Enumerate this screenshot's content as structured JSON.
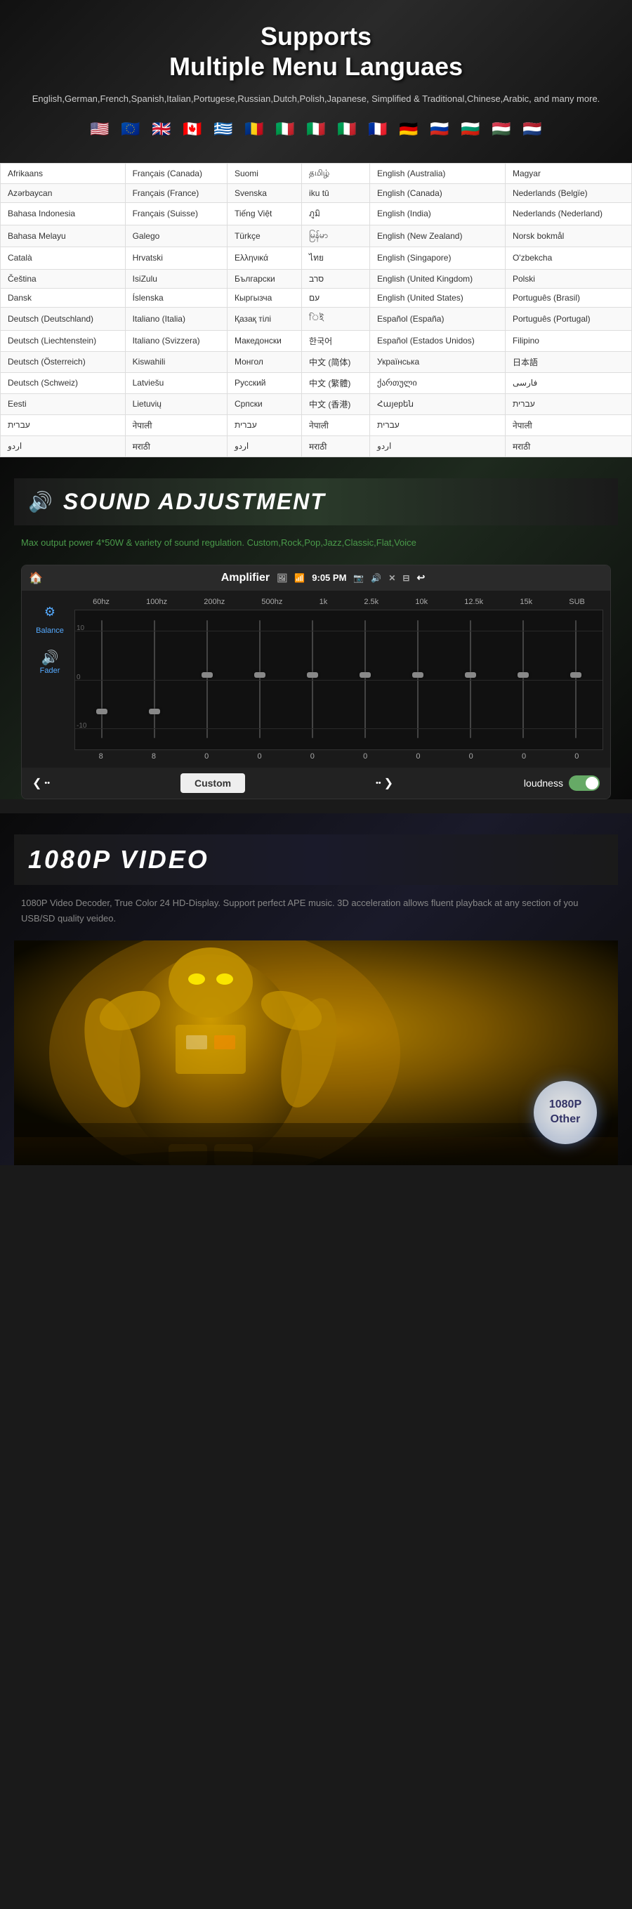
{
  "languages_section": {
    "title_line1": "Supports",
    "title_line2": "Multiple Menu Languaes",
    "subtitle": "English,German,French,Spanish,Italian,Portugese,Russian,Dutch,Polish,Japanese,\nSimplified & Traditional,Chinese,Arabic, and many more.",
    "flags": [
      "🇺🇸",
      "🇪🇺",
      "🇬🇧",
      "🇨🇦",
      "🇬🇷",
      "🇷🇴",
      "🇮🇹",
      "🇮🇹",
      "🇮🇹",
      "🇫🇷",
      "🇩🇪",
      "🇷🇺",
      "🇧🇬",
      "🇭🇺",
      "🇳🇱"
    ],
    "table_rows": [
      [
        "Afrikaans",
        "Français (Canada)",
        "Suomi",
        "தமிழ்",
        "English (Australia)",
        "Magyar"
      ],
      [
        "Azərbaycan",
        "Français (France)",
        "Svenska",
        "iku tū",
        "English (Canada)",
        "Nederlands (Belgïe)"
      ],
      [
        "Bahasa Indonesia",
        "Français (Suisse)",
        "Tiếng Việt",
        "ภูมิ",
        "English (India)",
        "Nederlands (Nederland)"
      ],
      [
        "Bahasa Melayu",
        "Galego",
        "Türkçe",
        "မြန်မာ",
        "English (New Zealand)",
        "Norsk bokmål"
      ],
      [
        "Català",
        "Hrvatski",
        "Ελληνικά",
        "ไทย",
        "English (Singapore)",
        "O'zbekcha"
      ],
      [
        "Čeština",
        "IsiZulu",
        "Български",
        "סרב",
        "English (United Kingdom)",
        "Polski"
      ],
      [
        "Dansk",
        "Íslenska",
        "Кыргызча",
        "עם",
        "English (United States)",
        "Português (Brasil)"
      ],
      [
        "Deutsch (Deutschland)",
        "Italiano (Italia)",
        "Қазақ тілі",
        "িই",
        "Español (España)",
        "Português (Portugal)"
      ],
      [
        "Deutsch (Liechtenstein)",
        "Italiano (Svizzera)",
        "Македонски",
        "한국어",
        "Español (Estados Unidos)",
        "Filipino"
      ],
      [
        "Deutsch (Österreich)",
        "Kiswahili",
        "Монгол",
        "中文 (简体)",
        "Українська",
        "日本語"
      ],
      [
        "Deutsch (Schweiz)",
        "Latviešu",
        "Русский",
        "中文 (繁體)",
        "ქართული",
        "فارسی"
      ],
      [
        "Eesti",
        "Lietuvių",
        "Српски",
        "中文 (香港)",
        "Հայерեն",
        "עברית"
      ],
      [
        "עברית",
        "नेपाली",
        "עברית",
        "नेपाली",
        "עברית",
        "नेपाली"
      ],
      [
        "اردو",
        "मराठी",
        "اردو",
        "मराठी",
        "اردو",
        "मराठी"
      ]
    ]
  },
  "sound_section": {
    "title": "SOUND ADJUSTMENT",
    "description": "Max output power 4*50W & variety of sound regulation.\nCustom,Rock,Pop,Jazz,Classic,Flat,Voice",
    "amplifier": {
      "label": "Amplifier",
      "time": "9:05 PM",
      "balance_label": "Balance",
      "fader_label": "Fader",
      "freq_labels": [
        "60hz",
        "100hz",
        "200hz",
        "500hz",
        "1k",
        "2.5k",
        "10k",
        "12.5k",
        "15k",
        "SUB"
      ],
      "eq_values": [
        8,
        8,
        0,
        0,
        0,
        0,
        0,
        0,
        0,
        0
      ],
      "eq_positions": [
        85,
        85,
        50,
        50,
        50,
        50,
        50,
        50,
        50,
        50
      ],
      "grid_labels": [
        "10",
        "0",
        "-10"
      ],
      "custom_label": "Custom",
      "loudness_label": "loudness",
      "prev_arrow": "❮",
      "next_arrow": "❯",
      "dots_left": "••",
      "dots_right": "••"
    }
  },
  "video_section": {
    "title": "1080P  VIDEO",
    "description": "1080P Video Decoder, True Color 24 HD-Display.\nSupport perfect APE music.\n3D acceleration allows fluent playback at any section of you USB/SD quality veideo.",
    "badge_line1": "1080P",
    "badge_line2": "Other"
  }
}
